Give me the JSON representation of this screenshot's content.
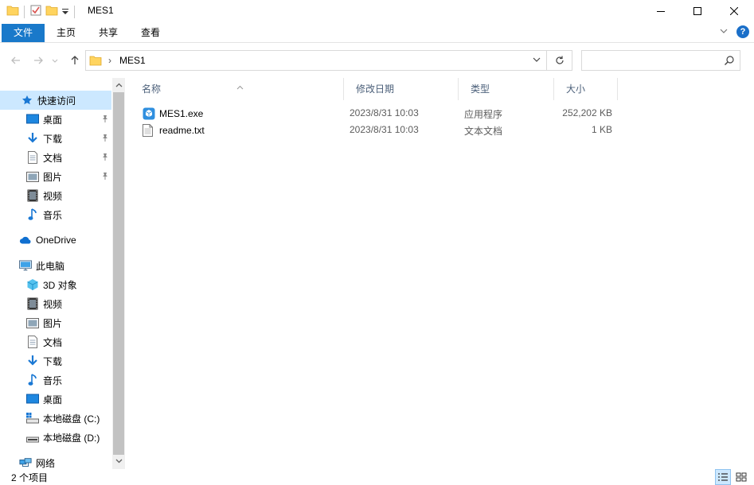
{
  "window": {
    "title": "MES1"
  },
  "ribbon": {
    "tabs": [
      {
        "label": "文件"
      },
      {
        "label": "主页"
      },
      {
        "label": "共享"
      },
      {
        "label": "查看"
      }
    ],
    "help_label": "?"
  },
  "address": {
    "path_separator": "›",
    "path": "MES1"
  },
  "search": {
    "placeholder": ""
  },
  "navpane": {
    "quick_access": "快速访问",
    "quick_items": [
      {
        "label": "桌面",
        "icon": "desktop-icon"
      },
      {
        "label": "下载",
        "icon": "download-icon"
      },
      {
        "label": "文档",
        "icon": "document-icon"
      },
      {
        "label": "图片",
        "icon": "picture-icon"
      },
      {
        "label": "视频",
        "icon": "video-icon"
      },
      {
        "label": "音乐",
        "icon": "music-icon"
      }
    ],
    "onedrive": "OneDrive",
    "this_pc": "此电脑",
    "pc_items": [
      {
        "label": "3D 对象",
        "icon": "3d-object-icon"
      },
      {
        "label": "视频",
        "icon": "video-icon"
      },
      {
        "label": "图片",
        "icon": "picture-icon"
      },
      {
        "label": "文档",
        "icon": "document-icon"
      },
      {
        "label": "下载",
        "icon": "download-icon"
      },
      {
        "label": "音乐",
        "icon": "music-icon"
      },
      {
        "label": "桌面",
        "icon": "desktop-icon"
      },
      {
        "label": "本地磁盘 (C:)",
        "icon": "drive-c-icon"
      },
      {
        "label": "本地磁盘 (D:)",
        "icon": "drive-icon"
      }
    ],
    "network": "网络"
  },
  "columns": {
    "name": "名称",
    "date": "修改日期",
    "type": "类型",
    "size": "大小"
  },
  "files": [
    {
      "name": "MES1.exe",
      "date": "2023/8/31 10:03",
      "type": "应用程序",
      "size": "252,202 KB",
      "icon": "exe-icon"
    },
    {
      "name": "readme.txt",
      "date": "2023/8/31 10:03",
      "type": "文本文档",
      "size": "1 KB",
      "icon": "txt-icon"
    }
  ],
  "status": {
    "item_count": "2 个项目"
  },
  "colors": {
    "accent": "#1979ca",
    "selection": "#cce8ff",
    "folder": "#ffd45f"
  }
}
